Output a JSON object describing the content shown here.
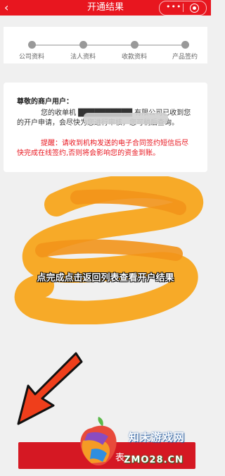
{
  "header": {
    "back_icon": "‹",
    "title": "开通结果",
    "more_icon": "•••",
    "color": "#e8161f"
  },
  "steps": [
    {
      "label": "公司资料"
    },
    {
      "label": "法人资料"
    },
    {
      "label": "收款资料"
    },
    {
      "label": "产品签约"
    }
  ],
  "message": {
    "greeting": "尊敬的商户用户：",
    "body": "您的收单机 ██████████ 有限公司已收到您的开户申请，会尽快为您进行审核，您可稍后查询。",
    "reminder": "提醒：请收到机构发送的电子合同签约短信后尽快完成在线签约,否则将会影响您的资金到账。"
  },
  "overlay": {
    "instruction": "点完成点击返回列表查看开户结果"
  },
  "bottom_button": {
    "label": "表"
  },
  "watermark": {
    "name": "知末游戏网",
    "domain": "ZMO28.CN"
  }
}
